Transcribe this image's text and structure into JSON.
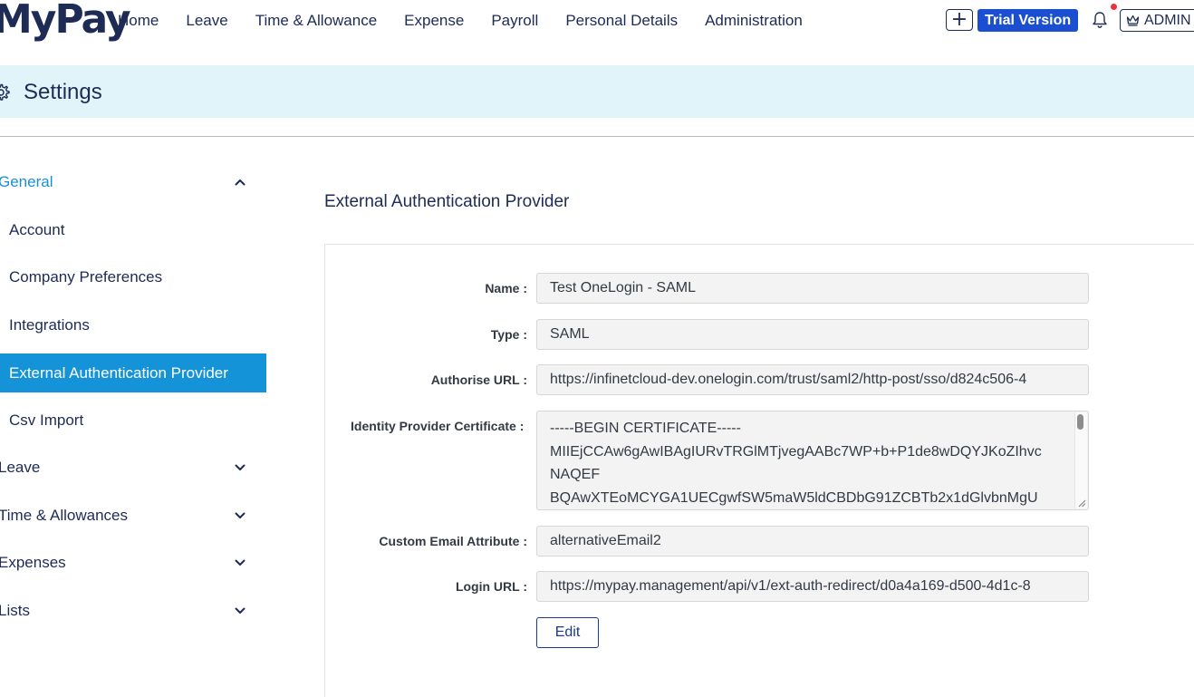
{
  "app": {
    "logo_text": "MyPay"
  },
  "nav": {
    "items": [
      {
        "label": "Home"
      },
      {
        "label": "Leave"
      },
      {
        "label": "Time & Allowance"
      },
      {
        "label": "Expense"
      },
      {
        "label": "Payroll"
      },
      {
        "label": "Personal Details"
      },
      {
        "label": "Administration"
      }
    ],
    "plus_label": "+",
    "trial_label": "Trial Version",
    "admin_label": "ADMIN",
    "icons": {
      "plus": "plus-icon",
      "bell": "bell-icon",
      "admin": "crown-icon"
    },
    "notification_color": "#e5353a"
  },
  "page": {
    "title": "Settings",
    "title_icon": "gear-icon",
    "header_bg": "#e1f4fa"
  },
  "sidebar": {
    "general": {
      "label": "General",
      "items": [
        {
          "label": "Account"
        },
        {
          "label": "Company Preferences"
        },
        {
          "label": "Integrations"
        },
        {
          "label": "External Authentication Provider"
        },
        {
          "label": "Csv Import"
        }
      ]
    },
    "groups": [
      {
        "label": "Leave"
      },
      {
        "label": "Time & Allowances"
      },
      {
        "label": "Expenses"
      },
      {
        "label": "Lists"
      }
    ],
    "selected_color": "#1593d9",
    "active_group_color": "#1a8fd6"
  },
  "main": {
    "title": "External Authentication Provider",
    "fields": {
      "name": {
        "label": "Name :",
        "value": "Test OneLogin - SAML"
      },
      "type": {
        "label": "Type :",
        "value": "SAML"
      },
      "authorise_url": {
        "label": "Authorise URL :",
        "value": "https://infinetcloud-dev.onelogin.com/trust/saml2/http-post/sso/d824c506-4"
      },
      "certificate": {
        "label": "Identity Provider Certificate :",
        "lines": [
          "-----BEGIN CERTIFICATE-----",
          "MIIEjCCAw6gAwIBAgIURvTRGlMTjvegAABc7WP+b+P1de8wDQYJKoZIhvc",
          "NAQEF",
          "BQAwXTEoMCYGA1UECgwfSW5maW5ldCBDbG91ZCBTb2x1dGlvbnMgU"
        ]
      },
      "custom_email": {
        "label": "Custom Email Attribute :",
        "value": "alternativeEmail2"
      },
      "login_url": {
        "label": "Login URL :",
        "value": "https://mypay.management/api/v1/ext-auth-redirect/d0a4a169-d500-4d1c-8"
      }
    },
    "edit_label": "Edit",
    "accent_color": "#1d3a8a"
  }
}
